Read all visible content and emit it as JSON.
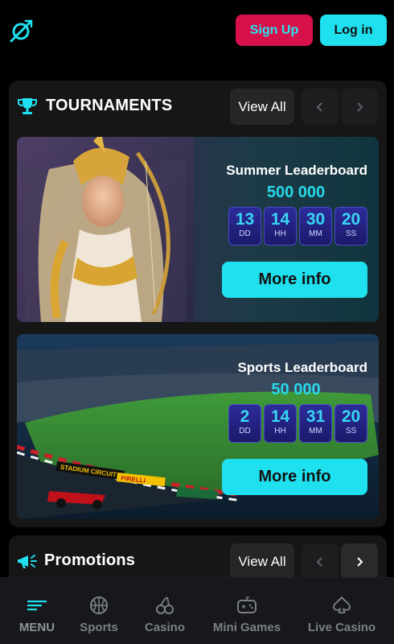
{
  "header": {
    "signup_label": "Sign Up",
    "login_label": "Log in",
    "accent": "#1fe0ee",
    "signup_color": "#d6104a"
  },
  "tournaments": {
    "title": "TOURNAMENTS",
    "view_all_label": "View All",
    "cards": [
      {
        "name": "Summer Leaderboard",
        "prize": "500 000",
        "timer": [
          {
            "value": "13",
            "unit": "DD"
          },
          {
            "value": "14",
            "unit": "HH"
          },
          {
            "value": "30",
            "unit": "MM"
          },
          {
            "value": "20",
            "unit": "SS"
          }
        ],
        "button_label": "More info"
      },
      {
        "name": "Sports Leaderboard",
        "prize": "50 000",
        "timer": [
          {
            "value": "2",
            "unit": "DD"
          },
          {
            "value": "14",
            "unit": "HH"
          },
          {
            "value": "31",
            "unit": "MM"
          },
          {
            "value": "20",
            "unit": "SS"
          }
        ],
        "button_label": "More info",
        "banner_text": [
          "STADIUM CIRCUIT",
          "PIRELLI"
        ]
      }
    ]
  },
  "promotions": {
    "title": "Promotions",
    "view_all_label": "View All"
  },
  "bottom_nav": {
    "items": [
      {
        "label": "MENU",
        "icon": "menu-icon"
      },
      {
        "label": "Sports",
        "icon": "basketball-icon"
      },
      {
        "label": "Casino",
        "icon": "cherries-icon"
      },
      {
        "label": "Mini Games",
        "icon": "gamepad-icon"
      },
      {
        "label": "Live Casino",
        "icon": "spade-icon"
      }
    ]
  }
}
